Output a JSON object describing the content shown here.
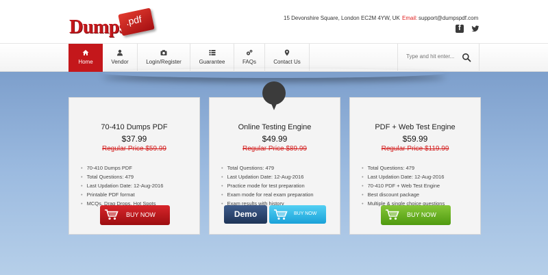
{
  "header": {
    "logo_text": "Dumps",
    "logo_badge": ".pdf",
    "address": "15 Devonshire Square, London EC2M 4YW, UK",
    "email_label": "Email:",
    "email_value": "support@dumpspdf.com",
    "social": [
      "facebook-icon",
      "twitter-icon"
    ]
  },
  "nav": {
    "items": [
      {
        "label": "Home",
        "icon": "home-icon",
        "active": true
      },
      {
        "label": "Vendor",
        "icon": "user-icon"
      },
      {
        "label": "Login/Register",
        "icon": "camera-icon"
      },
      {
        "label": "Guarantee",
        "icon": "list-icon"
      },
      {
        "label": "FAQs",
        "icon": "cogs-icon"
      },
      {
        "label": "Contact Us",
        "icon": "map-marker-icon"
      }
    ],
    "search_placeholder": "Type and hit enter..."
  },
  "cards": [
    {
      "title": "70-410 Dumps PDF",
      "price": "$37.99",
      "regular": "Regular Price $59.99",
      "features": [
        "70-410 Dumps PDF",
        "Total Questions: 479",
        "Last Updation Date: 12-Aug-2016",
        "Printable PDF format",
        "MCQs, Drag Drops, Hot Spots"
      ],
      "button": "BUY NOW"
    },
    {
      "title": "Online Testing Engine",
      "price": "$49.99",
      "regular": "Regular Price $89.99",
      "features": [
        "Total Questions: 479",
        "Last Updation Date: 12-Aug-2016",
        "Practice mode for test preparation",
        "Exam mode for real exam preparation",
        "Exam results with history"
      ],
      "demo_button": "Demo",
      "button": "BUY NOW"
    },
    {
      "title": "PDF + Web Test Engine",
      "price": "$59.99",
      "regular": "Regular Price $119.99",
      "features": [
        "Total Questions: 479",
        "Last Updation Date: 12-Aug-2016",
        "70-410 PDF + Web Test Engine",
        "Best discount package",
        "Multiple & single choice questions"
      ],
      "button": "BUY NOW"
    }
  ],
  "colors": {
    "brand_red": "#c4171b",
    "buy_green": "#6ab425",
    "buy_cyan": "#2cb4e6",
    "demo_blue": "#2c4670"
  }
}
